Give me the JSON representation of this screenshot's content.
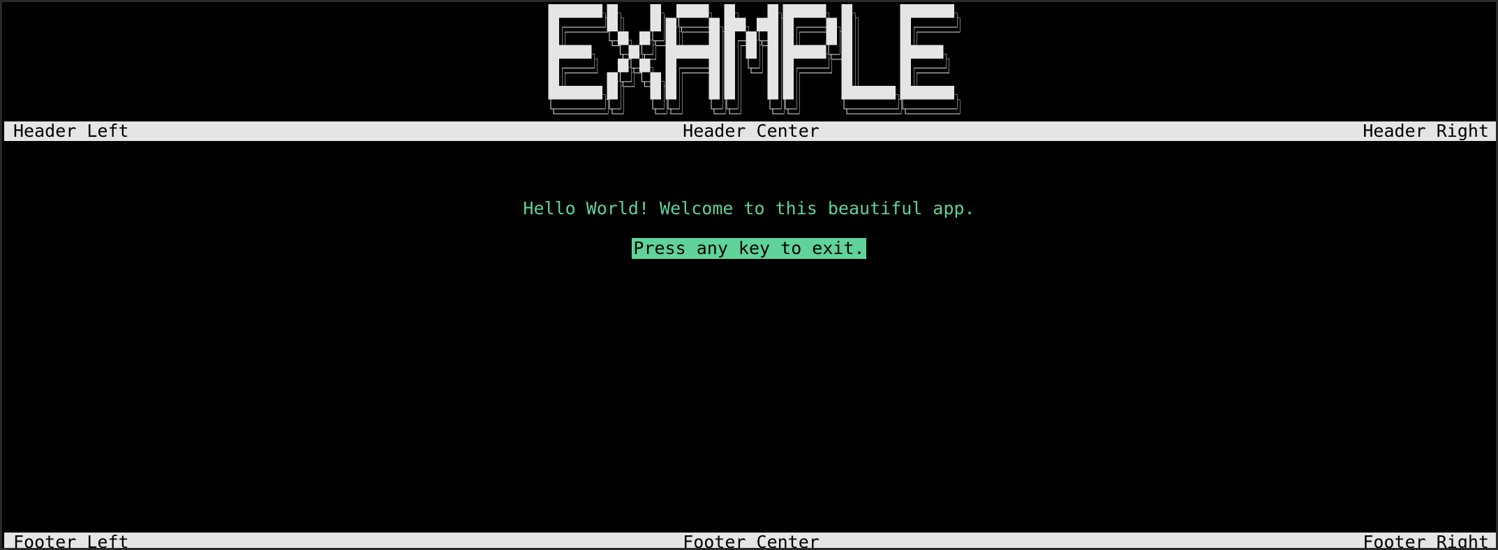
{
  "banner": {
    "text": "EXAMPLE",
    "color": "#e5e5e5"
  },
  "header": {
    "left": "Header Left",
    "center": "Header Center",
    "right": "Header Right"
  },
  "main": {
    "welcome": "Hello World! Welcome to this beautiful app.",
    "prompt": "Press any key to exit.",
    "accent_color": "#5fd39a"
  },
  "footer": {
    "left": "Footer Left",
    "center": "Footer Center",
    "right": "Footer Right"
  }
}
